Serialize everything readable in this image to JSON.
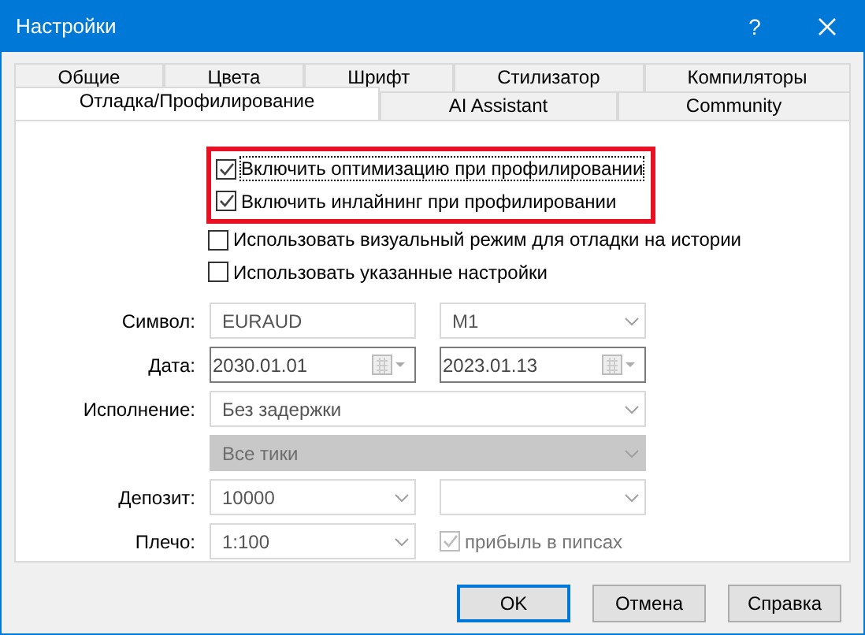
{
  "window": {
    "title": "Настройки",
    "help": "?"
  },
  "tab_rows": [
    [
      {
        "label": "Общие",
        "selected": false
      },
      {
        "label": "Цвета",
        "selected": false
      },
      {
        "label": "Шрифт",
        "selected": false
      },
      {
        "label": "Стилизатор",
        "selected": false
      },
      {
        "label": "Компиляторы",
        "selected": false
      }
    ],
    [
      {
        "label": "Отладка/Профилирование",
        "selected": true
      },
      {
        "label": "AI Assistant",
        "selected": false
      },
      {
        "label": "Community",
        "selected": false
      }
    ]
  ],
  "checkboxes": [
    {
      "label": "Включить оптимизацию при профилировании",
      "checked": true,
      "highlighted": true,
      "focused": true
    },
    {
      "label": "Включить инлайнинг при профилировании",
      "checked": true,
      "highlighted": true,
      "focused": false
    },
    {
      "label": "Использовать визуальный режим для отладки на истории",
      "checked": false,
      "highlighted": false,
      "focused": false
    },
    {
      "label": "Использовать указанные настройки",
      "checked": false,
      "highlighted": false,
      "focused": false
    }
  ],
  "form": [
    {
      "label": "Символ:",
      "fields": [
        {
          "kind": "text",
          "value": "EURAUD",
          "disabled": false
        },
        {
          "kind": "combo",
          "value": "M1",
          "disabled": false
        }
      ]
    },
    {
      "label": "Дата:",
      "fields": [
        {
          "kind": "date",
          "value": "2030.01.01",
          "disabled": false
        },
        {
          "kind": "date",
          "value": "2023.01.13",
          "disabled": false
        }
      ]
    },
    {
      "label": "Исполнение:",
      "fields": [
        {
          "kind": "combo",
          "value": "Без задержки",
          "disabled": false
        }
      ]
    },
    {
      "fields": [
        {
          "kind": "combo",
          "value": "Все тики",
          "disabled": true
        }
      ]
    },
    {
      "label": "Депозит:",
      "fields": [
        {
          "kind": "combo",
          "value": "10000",
          "disabled": false
        },
        {
          "kind": "combo",
          "disabled": false
        }
      ]
    },
    {
      "label": "Плечо:",
      "fields": [
        {
          "kind": "combo",
          "value": "1:100",
          "disabled": false
        },
        {
          "kind": "checkbox",
          "label": "прибыль в пипсах",
          "checked": true,
          "disabled": true
        }
      ]
    }
  ],
  "buttons": [
    {
      "label": "OK",
      "default": true
    },
    {
      "label": "Отмена",
      "default": false
    },
    {
      "label": "Справка",
      "default": false
    }
  ]
}
